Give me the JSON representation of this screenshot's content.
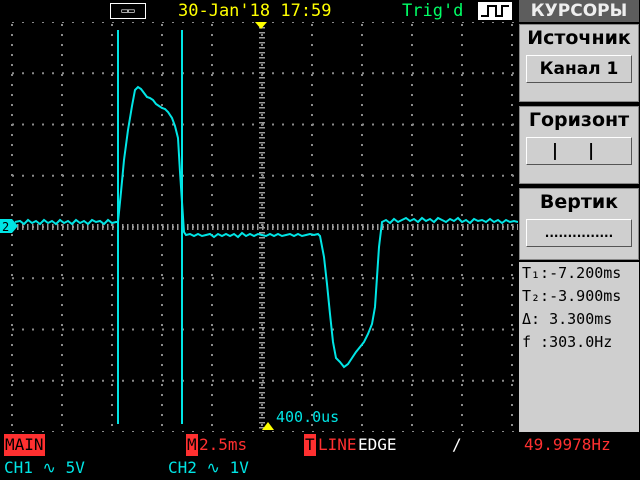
{
  "header": {
    "usb_icon": "usb-icon",
    "datetime": "30-Jan'18 17:59",
    "trigger_status": "Trig'd"
  },
  "waveform": {
    "channel_marker": "2",
    "horizontal_position": "400.0us"
  },
  "menu": {
    "title": "КУРСОРЫ",
    "source_label": "Источник",
    "source_value": "Канал 1",
    "horizontal_label": "Горизонт",
    "horizontal_value": "| |",
    "vertical_label": "Вертик",
    "vertical_value": "..............."
  },
  "readout": {
    "t1": "T₁:-7.200ms",
    "t2": "T₂:-3.900ms",
    "delta": "Δ: 3.300ms",
    "freq": "f :303.0Hz"
  },
  "status": {
    "mode": "MAIN",
    "timebase_prefix": "M",
    "timebase": "2.5ms",
    "trigger_prefix": "T",
    "trigger_source": "LINE",
    "trigger_type": "EDGE",
    "trigger_slope": "/",
    "frequency": "49.9978Hz",
    "ch1": "CH1 ∿ 5V",
    "ch2": "CH2 ∿ 1V"
  },
  "colors": {
    "trace": "#00e5e5",
    "grid": "#9a9a9a",
    "date": "#ffff00",
    "trigger": "#00ff66",
    "menu_bg": "#cfcfcf",
    "status_red": "#ff3030",
    "channel": "#00e5e5"
  }
}
